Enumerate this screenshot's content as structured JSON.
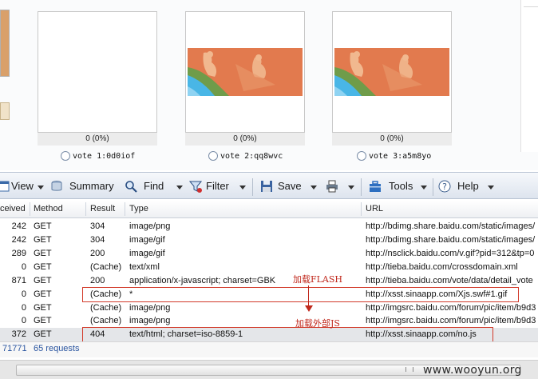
{
  "poll": {
    "options": [
      {
        "percent": "0 (0%)",
        "label": "vote 1:0d0iof",
        "has_image": false
      },
      {
        "percent": "0 (0%)",
        "label": "vote 2:qq8wvc",
        "has_image": true
      },
      {
        "percent": "0 (0%)",
        "label": "vote 3:a5m8yo",
        "has_image": true
      }
    ]
  },
  "toolbar": {
    "view": "View",
    "summary": "Summary",
    "find": "Find",
    "filter": "Filter",
    "save": "Save",
    "tools": "Tools",
    "help": "Help"
  },
  "table": {
    "headers": [
      "ceived",
      "Method",
      "Result",
      "Type",
      "URL"
    ],
    "rows": [
      {
        "received": "242",
        "method": "GET",
        "result": "304",
        "type": "image/png",
        "url": "http://bdimg.share.baidu.com/static/images/"
      },
      {
        "received": "242",
        "method": "GET",
        "result": "304",
        "type": "image/gif",
        "url": "http://bdimg.share.baidu.com/static/images/"
      },
      {
        "received": "289",
        "method": "GET",
        "result": "200",
        "type": "image/gif",
        "url": "http://nsclick.baidu.com/v.gif?pid=312&tp=0"
      },
      {
        "received": "0",
        "method": "GET",
        "result": "(Cache)",
        "type": "text/xml",
        "url": "http://tieba.baidu.com/crossdomain.xml"
      },
      {
        "received": "871",
        "method": "GET",
        "result": "200",
        "type": "application/x-javascript; charset=GBK",
        "url": "http://tieba.baidu.com/vote/data/detail_vote"
      },
      {
        "received": "0",
        "method": "GET",
        "result": "(Cache)",
        "type": "*",
        "url": "http://xsst.sinaapp.com/Xjs.swf#1.gif"
      },
      {
        "received": "0",
        "method": "GET",
        "result": "(Cache)",
        "type": "image/png",
        "url": "http://imgsrc.baidu.com/forum/pic/item/b9d3"
      },
      {
        "received": "0",
        "method": "GET",
        "result": "(Cache)",
        "type": "image/png",
        "url": "http://imgsrc.baidu.com/forum/pic/item/b9d3"
      },
      {
        "received": "372",
        "method": "GET",
        "result": "404",
        "type": "text/html; charset=iso-8859-1",
        "url": "http://xsst.sinaapp.com/no.js"
      }
    ]
  },
  "annotations": {
    "flash": "加载FLASH",
    "js": "加载外部JS"
  },
  "status": {
    "bytes": "71771",
    "requests": "65 requests"
  },
  "watermark": "www.wooyun.org",
  "colors": {
    "annotation_red": "#d23a2a",
    "selected_row": "#e4e6e9"
  }
}
